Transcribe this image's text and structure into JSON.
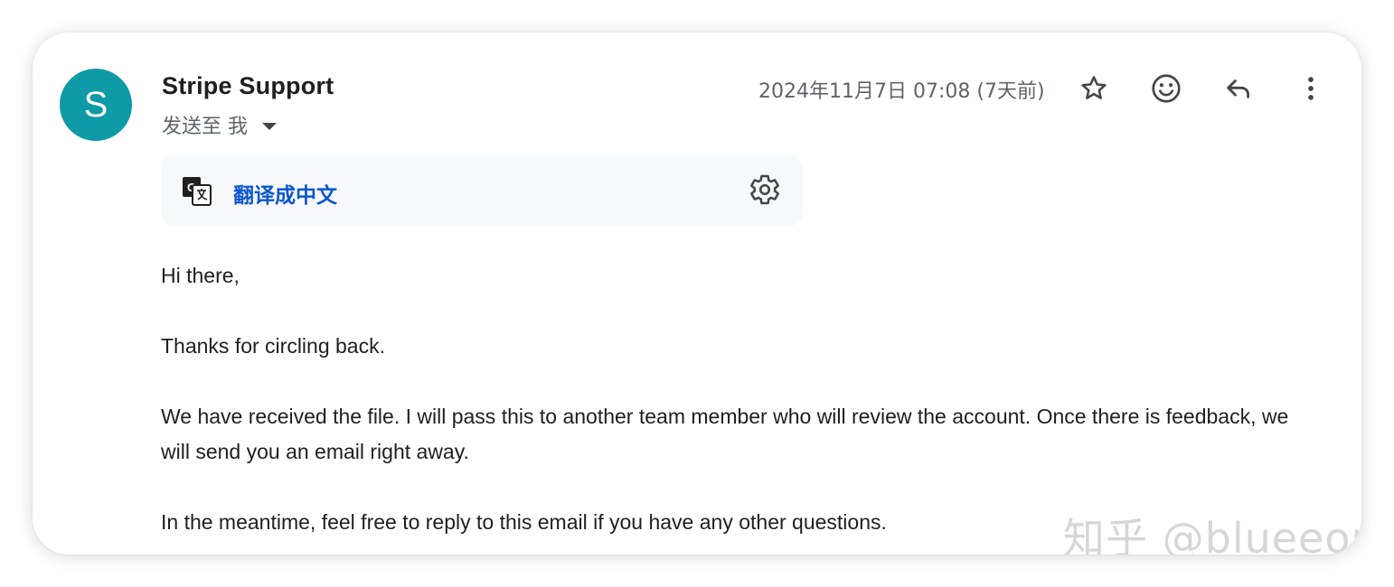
{
  "email": {
    "avatar_letter": "S",
    "avatar_color": "#0f9aa7",
    "sender": "Stripe Support",
    "recipient": "发送至 我",
    "timestamp": "2024年11月7日 07:08 (7天前)"
  },
  "actions": {
    "star": "star-icon",
    "emoji": "emoji-icon",
    "reply": "reply-icon",
    "more": "more-vert-icon"
  },
  "translate": {
    "label": "翻译成中文",
    "link_color": "#0b57d0"
  },
  "body": {
    "greeting": "Hi there,",
    "p1": "Thanks for circling back.",
    "p2": "We have received the file. I will pass this to another team member who will review the account. Once there is feedback, we will send you an email right away.",
    "p3": "In the meantime, feel free to reply to this email if you have any other questions."
  },
  "watermark": "知乎 @blueeon"
}
